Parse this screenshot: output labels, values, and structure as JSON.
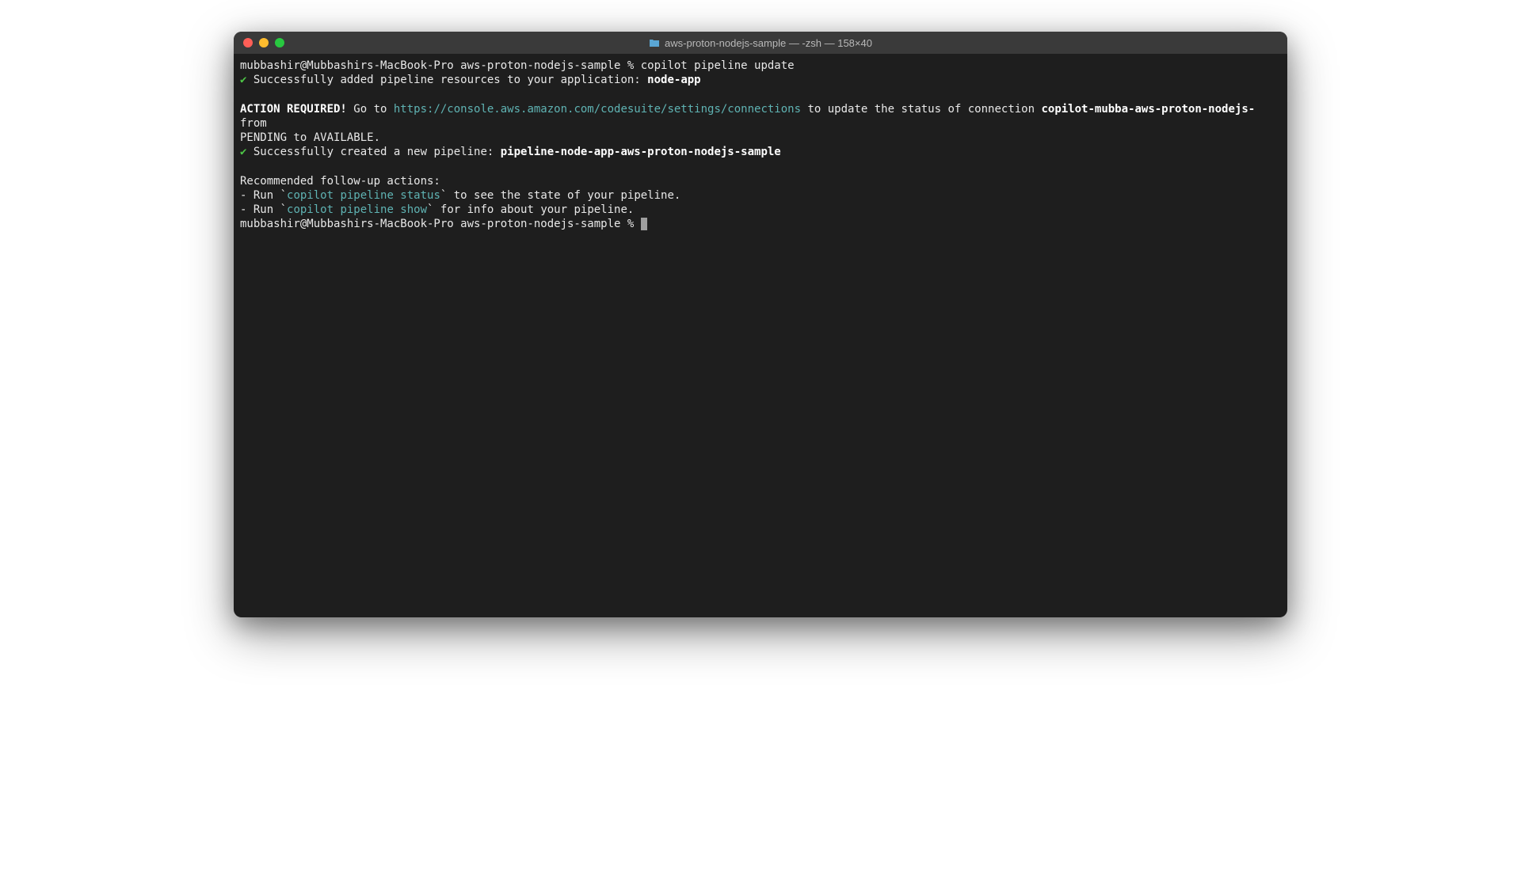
{
  "window": {
    "title": "aws-proton-nodejs-sample — -zsh — 158×40"
  },
  "terminal": {
    "line1_prompt": "mubbashir@Mubbashirs-MacBook-Pro aws-proton-nodejs-sample % ",
    "line1_cmd": "copilot pipeline update",
    "check": "✔",
    "line2_text": " Successfully added pipeline resources to your application: ",
    "line2_bold": "node-app",
    "action_required": "ACTION REQUIRED!",
    "line4_pre": " Go to ",
    "line4_link": "https://console.aws.amazon.com/codesuite/settings/connections",
    "line4_post": " to update the status of connection ",
    "line4_bold": "copilot-mubba-aws-proton-nodejs-",
    "line4_end": " from ",
    "line5": "PENDING to AVAILABLE.",
    "line6_text": " Successfully created a new pipeline: ",
    "line6_bold": "pipeline-node-app-aws-proton-nodejs-sample",
    "line8": "Recommended follow-up actions:",
    "line9_pre": "- Run `",
    "line9_cmd": "copilot pipeline status",
    "line9_post": "` to see the state of your pipeline.",
    "line10_pre": "- Run `",
    "line10_cmd": "copilot pipeline show",
    "line10_post": "` for info about your pipeline.",
    "line11_prompt": "mubbashir@Mubbashirs-MacBook-Pro aws-proton-nodejs-sample % "
  }
}
